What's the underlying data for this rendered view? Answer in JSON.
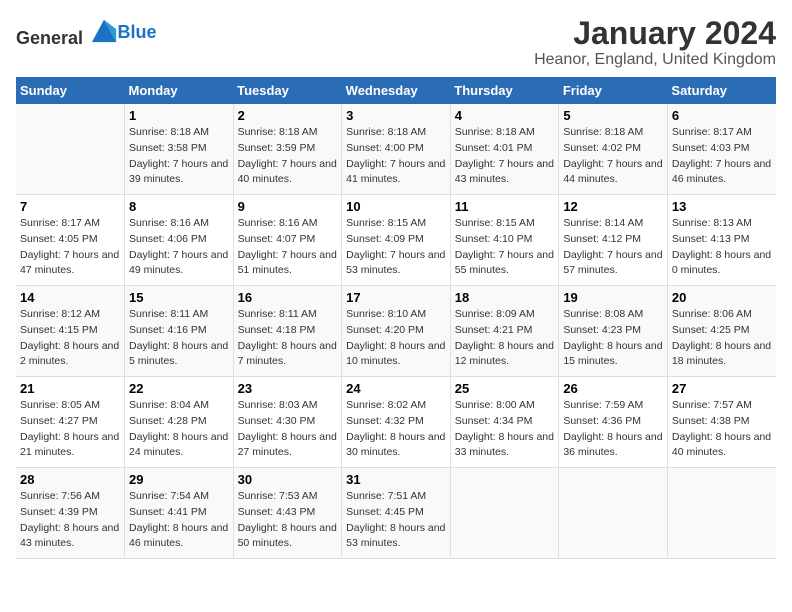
{
  "logo": {
    "text_general": "General",
    "text_blue": "Blue"
  },
  "title": "January 2024",
  "subtitle": "Heanor, England, United Kingdom",
  "days_header": [
    "Sunday",
    "Monday",
    "Tuesday",
    "Wednesday",
    "Thursday",
    "Friday",
    "Saturday"
  ],
  "weeks": [
    [
      {
        "day": "",
        "sunrise": "",
        "sunset": "",
        "daylight": ""
      },
      {
        "day": "1",
        "sunrise": "Sunrise: 8:18 AM",
        "sunset": "Sunset: 3:58 PM",
        "daylight": "Daylight: 7 hours and 39 minutes."
      },
      {
        "day": "2",
        "sunrise": "Sunrise: 8:18 AM",
        "sunset": "Sunset: 3:59 PM",
        "daylight": "Daylight: 7 hours and 40 minutes."
      },
      {
        "day": "3",
        "sunrise": "Sunrise: 8:18 AM",
        "sunset": "Sunset: 4:00 PM",
        "daylight": "Daylight: 7 hours and 41 minutes."
      },
      {
        "day": "4",
        "sunrise": "Sunrise: 8:18 AM",
        "sunset": "Sunset: 4:01 PM",
        "daylight": "Daylight: 7 hours and 43 minutes."
      },
      {
        "day": "5",
        "sunrise": "Sunrise: 8:18 AM",
        "sunset": "Sunset: 4:02 PM",
        "daylight": "Daylight: 7 hours and 44 minutes."
      },
      {
        "day": "6",
        "sunrise": "Sunrise: 8:17 AM",
        "sunset": "Sunset: 4:03 PM",
        "daylight": "Daylight: 7 hours and 46 minutes."
      }
    ],
    [
      {
        "day": "7",
        "sunrise": "Sunrise: 8:17 AM",
        "sunset": "Sunset: 4:05 PM",
        "daylight": "Daylight: 7 hours and 47 minutes."
      },
      {
        "day": "8",
        "sunrise": "Sunrise: 8:16 AM",
        "sunset": "Sunset: 4:06 PM",
        "daylight": "Daylight: 7 hours and 49 minutes."
      },
      {
        "day": "9",
        "sunrise": "Sunrise: 8:16 AM",
        "sunset": "Sunset: 4:07 PM",
        "daylight": "Daylight: 7 hours and 51 minutes."
      },
      {
        "day": "10",
        "sunrise": "Sunrise: 8:15 AM",
        "sunset": "Sunset: 4:09 PM",
        "daylight": "Daylight: 7 hours and 53 minutes."
      },
      {
        "day": "11",
        "sunrise": "Sunrise: 8:15 AM",
        "sunset": "Sunset: 4:10 PM",
        "daylight": "Daylight: 7 hours and 55 minutes."
      },
      {
        "day": "12",
        "sunrise": "Sunrise: 8:14 AM",
        "sunset": "Sunset: 4:12 PM",
        "daylight": "Daylight: 7 hours and 57 minutes."
      },
      {
        "day": "13",
        "sunrise": "Sunrise: 8:13 AM",
        "sunset": "Sunset: 4:13 PM",
        "daylight": "Daylight: 8 hours and 0 minutes."
      }
    ],
    [
      {
        "day": "14",
        "sunrise": "Sunrise: 8:12 AM",
        "sunset": "Sunset: 4:15 PM",
        "daylight": "Daylight: 8 hours and 2 minutes."
      },
      {
        "day": "15",
        "sunrise": "Sunrise: 8:11 AM",
        "sunset": "Sunset: 4:16 PM",
        "daylight": "Daylight: 8 hours and 5 minutes."
      },
      {
        "day": "16",
        "sunrise": "Sunrise: 8:11 AM",
        "sunset": "Sunset: 4:18 PM",
        "daylight": "Daylight: 8 hours and 7 minutes."
      },
      {
        "day": "17",
        "sunrise": "Sunrise: 8:10 AM",
        "sunset": "Sunset: 4:20 PM",
        "daylight": "Daylight: 8 hours and 10 minutes."
      },
      {
        "day": "18",
        "sunrise": "Sunrise: 8:09 AM",
        "sunset": "Sunset: 4:21 PM",
        "daylight": "Daylight: 8 hours and 12 minutes."
      },
      {
        "day": "19",
        "sunrise": "Sunrise: 8:08 AM",
        "sunset": "Sunset: 4:23 PM",
        "daylight": "Daylight: 8 hours and 15 minutes."
      },
      {
        "day": "20",
        "sunrise": "Sunrise: 8:06 AM",
        "sunset": "Sunset: 4:25 PM",
        "daylight": "Daylight: 8 hours and 18 minutes."
      }
    ],
    [
      {
        "day": "21",
        "sunrise": "Sunrise: 8:05 AM",
        "sunset": "Sunset: 4:27 PM",
        "daylight": "Daylight: 8 hours and 21 minutes."
      },
      {
        "day": "22",
        "sunrise": "Sunrise: 8:04 AM",
        "sunset": "Sunset: 4:28 PM",
        "daylight": "Daylight: 8 hours and 24 minutes."
      },
      {
        "day": "23",
        "sunrise": "Sunrise: 8:03 AM",
        "sunset": "Sunset: 4:30 PM",
        "daylight": "Daylight: 8 hours and 27 minutes."
      },
      {
        "day": "24",
        "sunrise": "Sunrise: 8:02 AM",
        "sunset": "Sunset: 4:32 PM",
        "daylight": "Daylight: 8 hours and 30 minutes."
      },
      {
        "day": "25",
        "sunrise": "Sunrise: 8:00 AM",
        "sunset": "Sunset: 4:34 PM",
        "daylight": "Daylight: 8 hours and 33 minutes."
      },
      {
        "day": "26",
        "sunrise": "Sunrise: 7:59 AM",
        "sunset": "Sunset: 4:36 PM",
        "daylight": "Daylight: 8 hours and 36 minutes."
      },
      {
        "day": "27",
        "sunrise": "Sunrise: 7:57 AM",
        "sunset": "Sunset: 4:38 PM",
        "daylight": "Daylight: 8 hours and 40 minutes."
      }
    ],
    [
      {
        "day": "28",
        "sunrise": "Sunrise: 7:56 AM",
        "sunset": "Sunset: 4:39 PM",
        "daylight": "Daylight: 8 hours and 43 minutes."
      },
      {
        "day": "29",
        "sunrise": "Sunrise: 7:54 AM",
        "sunset": "Sunset: 4:41 PM",
        "daylight": "Daylight: 8 hours and 46 minutes."
      },
      {
        "day": "30",
        "sunrise": "Sunrise: 7:53 AM",
        "sunset": "Sunset: 4:43 PM",
        "daylight": "Daylight: 8 hours and 50 minutes."
      },
      {
        "day": "31",
        "sunrise": "Sunrise: 7:51 AM",
        "sunset": "Sunset: 4:45 PM",
        "daylight": "Daylight: 8 hours and 53 minutes."
      },
      {
        "day": "",
        "sunrise": "",
        "sunset": "",
        "daylight": ""
      },
      {
        "day": "",
        "sunrise": "",
        "sunset": "",
        "daylight": ""
      },
      {
        "day": "",
        "sunrise": "",
        "sunset": "",
        "daylight": ""
      }
    ]
  ]
}
